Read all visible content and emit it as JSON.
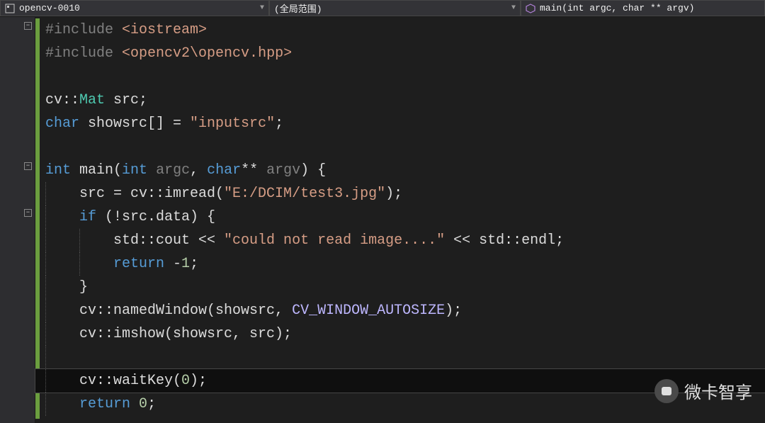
{
  "topbar": {
    "project": "opencv-0010",
    "scope": "(全局范围)",
    "function": "main(int argc, char ** argv)"
  },
  "code": {
    "l1a": "#include ",
    "l1b": "<iostream>",
    "l2a": "#include ",
    "l2b": "<opencv2\\opencv.hpp>",
    "l4a": "cv::",
    "l4b": "Mat",
    "l4c": " src;",
    "l5a": "char",
    "l5b": " showsrc[] = ",
    "l5c": "\"inputsrc\"",
    "l5d": ";",
    "l7a": "int",
    "l7b": " main(",
    "l7c": "int",
    "l7d": " ",
    "l7e": "argc",
    "l7f": ", ",
    "l7g": "char",
    "l7h": "** ",
    "l7i": "argv",
    "l7j": ") {",
    "l8a": "    src = cv::imread(",
    "l8b": "\"E:/DCIM/test3.jpg\"",
    "l8c": ");",
    "l9a": "    ",
    "l9b": "if",
    "l9c": " (!src.data) {",
    "l10a": "        std::cout << ",
    "l10b": "\"could not read image....\"",
    "l10c": " << std::endl;",
    "l11a": "        ",
    "l11b": "return",
    "l11c": " -",
    "l11d": "1",
    "l11e": ";",
    "l12a": "    }",
    "l13a": "    cv::namedWindow(showsrc, ",
    "l13b": "CV_WINDOW_AUTOSIZE",
    "l13c": ");",
    "l14a": "    cv::imshow(showsrc, src);",
    "l16a": "    cv::waitKey(",
    "l16b": "0",
    "l16c": ");",
    "l17a": "    ",
    "l17b": "return",
    "l17c": " ",
    "l17d": "0",
    "l17e": ";"
  },
  "watermark": "微卡智享"
}
